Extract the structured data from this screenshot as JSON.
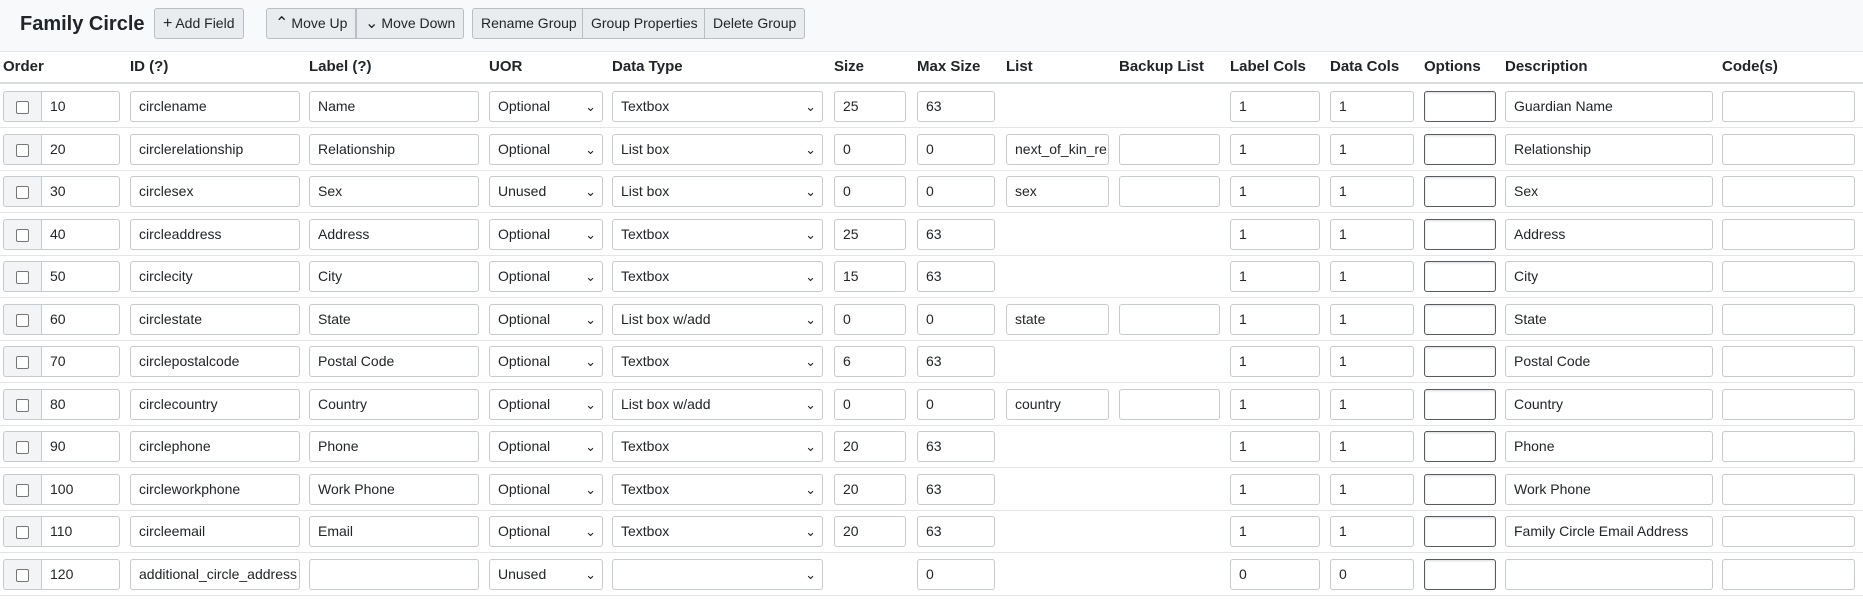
{
  "toolbar": {
    "title": "Family Circle",
    "add_field": "Add Field",
    "move_up": "Move Up",
    "move_down": "Move Down",
    "rename_group": "Rename Group",
    "group_properties": "Group Properties",
    "delete_group": "Delete Group",
    "icons": {
      "add": "plus-icon",
      "up": "chevron-up-icon",
      "down": "chevron-down-icon"
    }
  },
  "columns": {
    "order": "Order",
    "id": "ID (?)",
    "label": "Label (?)",
    "uor": "UOR",
    "data_type": "Data Type",
    "size": "Size",
    "max_size": "Max Size",
    "list": "List",
    "backup_list": "Backup List",
    "label_cols": "Label Cols",
    "data_cols": "Data Cols",
    "options": "Options",
    "description": "Description",
    "codes": "Code(s)"
  },
  "rows": [
    {
      "order": "10",
      "id": "circlename",
      "label": "Name",
      "uor": "Optional",
      "data_type": "Textbox",
      "size": "25",
      "max_size": "63",
      "list": null,
      "backup_list": null,
      "label_cols": "1",
      "data_cols": "1",
      "description": "Guardian Name",
      "codes": ""
    },
    {
      "order": "20",
      "id": "circlerelationship",
      "label": "Relationship",
      "uor": "Optional",
      "data_type": "List box",
      "size": "0",
      "max_size": "0",
      "list": "next_of_kin_re",
      "backup_list": "",
      "label_cols": "1",
      "data_cols": "1",
      "description": "Relationship",
      "codes": ""
    },
    {
      "order": "30",
      "id": "circlesex",
      "label": "Sex",
      "uor": "Unused",
      "data_type": "List box",
      "size": "0",
      "max_size": "0",
      "list": "sex",
      "backup_list": "",
      "label_cols": "1",
      "data_cols": "1",
      "description": "Sex",
      "codes": ""
    },
    {
      "order": "40",
      "id": "circleaddress",
      "label": "Address",
      "uor": "Optional",
      "data_type": "Textbox",
      "size": "25",
      "max_size": "63",
      "list": null,
      "backup_list": null,
      "label_cols": "1",
      "data_cols": "1",
      "description": "Address",
      "codes": ""
    },
    {
      "order": "50",
      "id": "circlecity",
      "label": "City",
      "uor": "Optional",
      "data_type": "Textbox",
      "size": "15",
      "max_size": "63",
      "list": null,
      "backup_list": null,
      "label_cols": "1",
      "data_cols": "1",
      "description": "City",
      "codes": ""
    },
    {
      "order": "60",
      "id": "circlestate",
      "label": "State",
      "uor": "Optional",
      "data_type": "List box w/add",
      "size": "0",
      "max_size": "0",
      "list": "state",
      "backup_list": "",
      "label_cols": "1",
      "data_cols": "1",
      "description": "State",
      "codes": ""
    },
    {
      "order": "70",
      "id": "circlepostalcode",
      "label": "Postal Code",
      "uor": "Optional",
      "data_type": "Textbox",
      "size": "6",
      "max_size": "63",
      "list": null,
      "backup_list": null,
      "label_cols": "1",
      "data_cols": "1",
      "description": "Postal Code",
      "codes": ""
    },
    {
      "order": "80",
      "id": "circlecountry",
      "label": "Country",
      "uor": "Optional",
      "data_type": "List box w/add",
      "size": "0",
      "max_size": "0",
      "list": "country",
      "backup_list": "",
      "label_cols": "1",
      "data_cols": "1",
      "description": "Country",
      "codes": ""
    },
    {
      "order": "90",
      "id": "circlephone",
      "label": "Phone",
      "uor": "Optional",
      "data_type": "Textbox",
      "size": "20",
      "max_size": "63",
      "list": null,
      "backup_list": null,
      "label_cols": "1",
      "data_cols": "1",
      "description": "Phone",
      "codes": ""
    },
    {
      "order": "100",
      "id": "circleworkphone",
      "label": "Work Phone",
      "uor": "Optional",
      "data_type": "Textbox",
      "size": "20",
      "max_size": "63",
      "list": null,
      "backup_list": null,
      "label_cols": "1",
      "data_cols": "1",
      "description": "Work Phone",
      "codes": ""
    },
    {
      "order": "110",
      "id": "circleemail",
      "label": "Email",
      "uor": "Optional",
      "data_type": "Textbox",
      "size": "20",
      "max_size": "63",
      "list": null,
      "backup_list": null,
      "label_cols": "1",
      "data_cols": "1",
      "description": "Family Circle Email Address",
      "codes": ""
    },
    {
      "order": "120",
      "id": "additional_circle_address",
      "label": "",
      "uor": "Unused",
      "data_type": "",
      "size": null,
      "max_size": "0",
      "list": null,
      "backup_list": null,
      "label_cols": "0",
      "data_cols": "0",
      "description": "",
      "codes": ""
    }
  ]
}
